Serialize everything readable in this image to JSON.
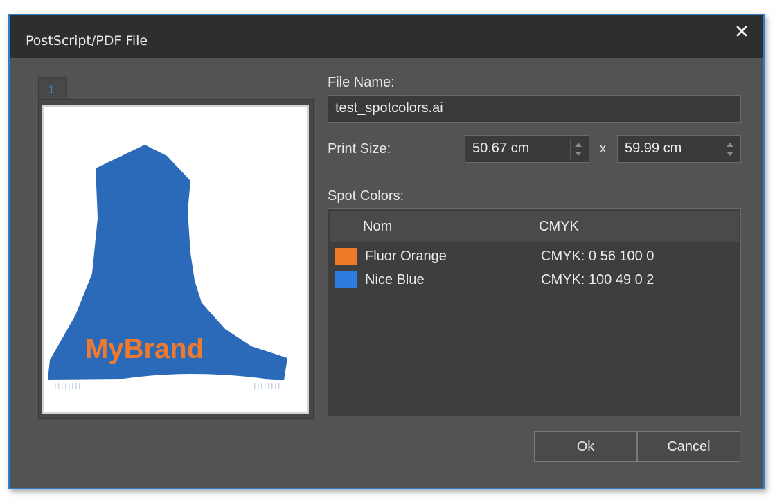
{
  "window": {
    "title": "PostScript/PDF File",
    "close_icon": "close-icon"
  },
  "preview": {
    "tab_label": "1",
    "artwork_text": "MyBrand",
    "artwork_shape_color": "#2b6ab8",
    "artwork_text_color": "#ef7a2e"
  },
  "form": {
    "file_name_label": "File Name:",
    "file_name_value": "test_spotcolors.ai",
    "print_size_label": "Print Size:",
    "width_value": "50.67 cm",
    "separator": "x",
    "height_value": "59.99 cm",
    "spot_colors_label": "Spot Colors:"
  },
  "spot_colors": {
    "columns": [
      "",
      "Nom",
      "CMYK"
    ],
    "rows": [
      {
        "swatch_color": "#f07a2a",
        "name": "Fluor Orange",
        "cmyk": "CMYK: 0 56 100 0"
      },
      {
        "swatch_color": "#2f7ce0",
        "name": "Nice Blue",
        "cmyk": "CMYK: 100 49 0 2"
      }
    ]
  },
  "buttons": {
    "ok": "Ok",
    "cancel": "Cancel"
  }
}
